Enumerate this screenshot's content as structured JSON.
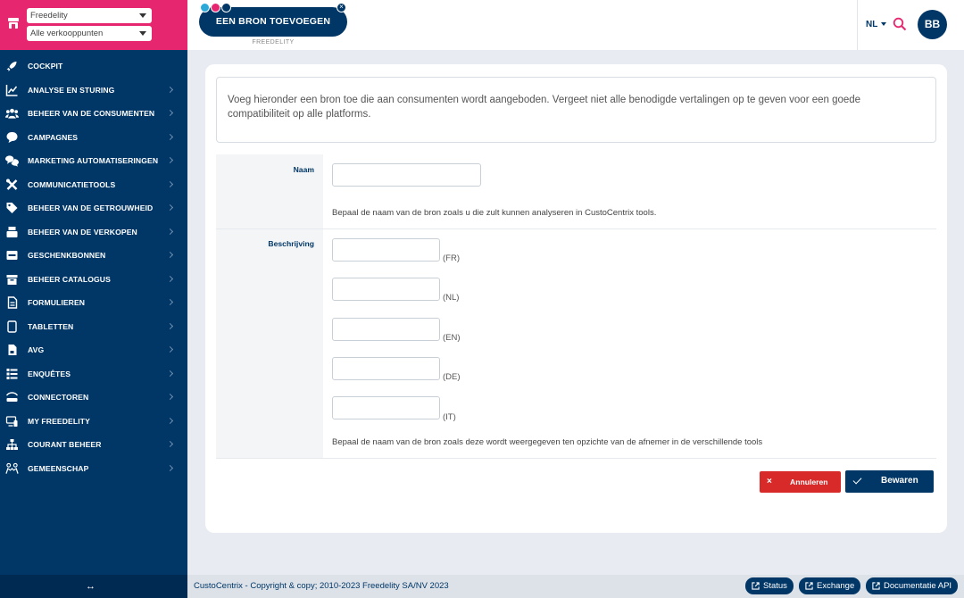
{
  "sidebar": {
    "selects": {
      "brand": "Freedelity",
      "pos": "Alle verkooppunten"
    },
    "items": [
      {
        "label": "COCKPIT",
        "icon": "rocket-icon",
        "chevron": false
      },
      {
        "label": "ANALYSE EN STURING",
        "icon": "chart-icon",
        "chevron": true
      },
      {
        "label": "BEHEER VAN DE CONSUMENTEN",
        "icon": "users-icon",
        "chevron": true
      },
      {
        "label": "CAMPAGNES",
        "icon": "chat-icon",
        "chevron": true
      },
      {
        "label": "MARKETING AUTOMATISERINGEN",
        "icon": "chats-icon",
        "chevron": true
      },
      {
        "label": "COMMUNICATIETOOLS",
        "icon": "tools-icon",
        "chevron": true
      },
      {
        "label": "BEHEER VAN DE GETROUWHEID",
        "icon": "loyalty-icon",
        "chevron": true
      },
      {
        "label": "BEHEER VAN DE VERKOPEN",
        "icon": "register-icon",
        "chevron": true
      },
      {
        "label": "GESCHENKBONNEN",
        "icon": "giftcard-icon",
        "chevron": true
      },
      {
        "label": "BEHEER CATALOGUS",
        "icon": "box-icon",
        "chevron": true
      },
      {
        "label": "FORMULIEREN",
        "icon": "form-icon",
        "chevron": true
      },
      {
        "label": "TABLETTEN",
        "icon": "tablet-icon",
        "chevron": true
      },
      {
        "label": "AVG",
        "icon": "file-lock-icon",
        "chevron": true
      },
      {
        "label": "ENQUÊTES",
        "icon": "survey-icon",
        "chevron": true
      },
      {
        "label": "CONNECTOREN",
        "icon": "connector-icon",
        "chevron": true
      },
      {
        "label": "MY FREEDELITY",
        "icon": "devices-icon",
        "chevron": true
      },
      {
        "label": "COURANT BEHEER",
        "icon": "sitemap-icon",
        "chevron": true
      },
      {
        "label": "GEMEENSCHAP",
        "icon": "community-icon",
        "chevron": true
      }
    ],
    "collapse": "↔"
  },
  "header": {
    "brand_button": "EEN BRON TOEVOEGEN",
    "brand_sub": "FREEDELITY",
    "lang": "NL",
    "avatar": "BB"
  },
  "form": {
    "info": "Voeg hieronder een bron toe die aan consumenten wordt aangeboden. Vergeet niet alle benodigde vertalingen op te geven voor een goede compatibiliteit op alle platforms.",
    "name_label": "Naam",
    "name_value": "",
    "name_hint": "Bepaal de naam van de bron zoals u die zult kunnen analyseren in CustoCentrix tools.",
    "desc_label": "Beschrijving",
    "desc_langs": [
      "(FR)",
      "(NL)",
      "(EN)",
      "(DE)",
      "(IT)"
    ],
    "desc_hint": "Bepaal de naam van de bron zoals deze wordt weergegeven ten opzichte van de afnemer in de verschillende tools",
    "cancel": "Annuleren",
    "save": "Bewaren"
  },
  "footer": {
    "copyright": "CustoCentrix - Copyright & copy; 2010-2023 Freedelity SA/NV 2023",
    "links": [
      "Status",
      "Exchange",
      "Documentatie API"
    ]
  },
  "colors": {
    "primary": "#003767",
    "accent": "#e6276f",
    "danger": "#d92a2a"
  }
}
